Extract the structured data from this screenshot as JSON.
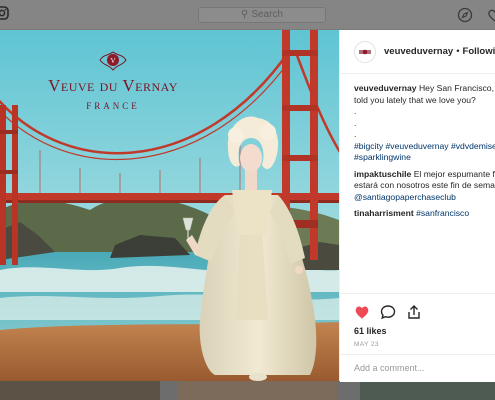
{
  "search": {
    "placeholder": "Search"
  },
  "post": {
    "username": "veuveduvernay",
    "follow_status": "Following",
    "separator": "•",
    "brand": {
      "name": "Veuve du Vernay",
      "subtitle": "FRANCE"
    },
    "caption": {
      "user": "veuveduvernay",
      "lines": [
        "Hey San Francisco, h",
        "told you lately that we love you?",
        ".",
        ".",
        "."
      ],
      "hashtags": [
        "#bigcity #veuveduvernay #vdvdemise",
        "#sparklingwine"
      ]
    },
    "comments": [
      {
        "user": "impaktuschile",
        "lines": [
          "El mejor espumante fra",
          "estará con nosotros este fin de seman"
        ],
        "mention": "@santiagopaperchaseclub"
      },
      {
        "user": "tinaharrisment",
        "tag": "#sanfrancisco"
      }
    ],
    "likes": "61 likes",
    "date": "MAY 23",
    "add_comment_placeholder": "Add a comment..."
  },
  "colors": {
    "like_red": "#ed4956",
    "link_blue": "#003569",
    "brand_burgundy": "#7a1424"
  }
}
